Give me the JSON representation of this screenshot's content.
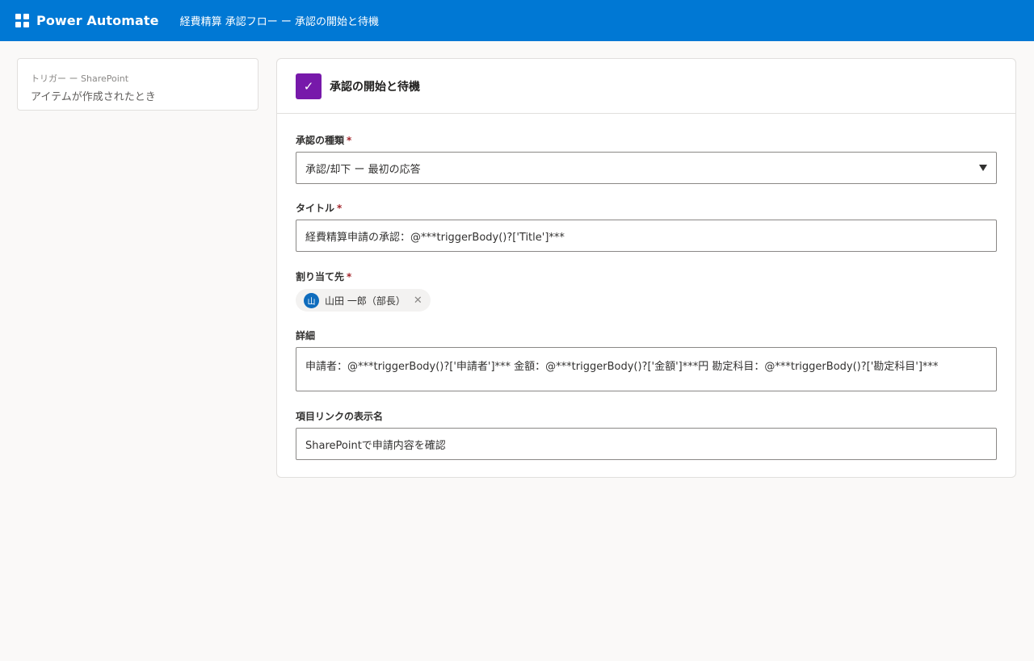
{
  "header": {
    "app_name": "Power Automate",
    "flow_title": "経費精算 承認フロー ー 承認の開始と待機",
    "color": "#0078d4"
  },
  "trigger": {
    "kind": "トリガー ー SharePoint",
    "name": "アイテムが作成されたとき"
  },
  "action": {
    "title": "承認の開始と待機",
    "icon": "checkmark-icon",
    "icon_color": "#7719aa",
    "fields": {
      "approval_type": {
        "label": "承認の種類",
        "required": "*",
        "value": "承認/却下 ー 最初の応答"
      },
      "title": {
        "label": "タイトル",
        "required": "*",
        "value": "経費精算申請の承認：@***triggerBody()?['Title']***"
      },
      "assigned_to": {
        "label": "割り当て先",
        "required": "*",
        "assignee_initial": "山",
        "assignee_name": "山田 一郎（部長）"
      },
      "details": {
        "label": "詳細",
        "value": "申請者：@***triggerBody()?['申請者']*** 金額：@***triggerBody()?['金額']***円 勘定科目：@***triggerBody()?['勘定科目']***"
      },
      "item_link_label": {
        "label": "項目リンクの表示名",
        "value": "SharePointで申請内容を確認"
      }
    }
  }
}
